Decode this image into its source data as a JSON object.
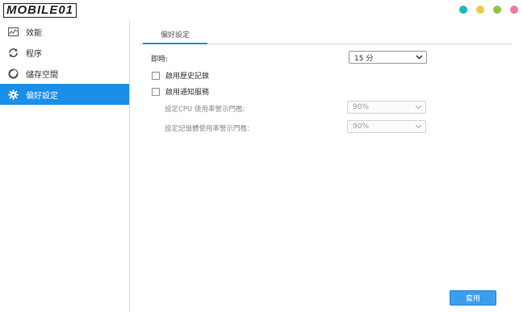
{
  "app": {
    "logo_text": "MOBILE01",
    "window_buttons": [
      {
        "name": "teal",
        "color": "#1fb7b7"
      },
      {
        "name": "yellow",
        "color": "#f5c842"
      },
      {
        "name": "green",
        "color": "#8cc63f"
      },
      {
        "name": "pink",
        "color": "#f07a9a"
      }
    ],
    "accent_color": "#1b8ee8"
  },
  "sidebar": {
    "items": [
      {
        "label": "效能",
        "icon": "performance-icon",
        "active": false
      },
      {
        "label": "程序",
        "icon": "process-icon",
        "active": false
      },
      {
        "label": "儲存空間",
        "icon": "storage-icon",
        "active": false
      },
      {
        "label": "偏好設定",
        "icon": "gear-icon",
        "active": true
      }
    ]
  },
  "main": {
    "tab_label": "偏好設定",
    "realtime": {
      "label": "即時:",
      "value": "15 分"
    },
    "history_checkbox": {
      "label": "啟用歷史記錄",
      "checked": false
    },
    "notify_checkbox": {
      "label": "啟用通知服務",
      "checked": false
    },
    "cpu_threshold": {
      "label": "設定CPU 使用率警示門檻:",
      "value": "90%"
    },
    "mem_threshold": {
      "label": "設定記憶體使用率警示門檻:",
      "value": "90%"
    },
    "apply_label": "套用"
  }
}
